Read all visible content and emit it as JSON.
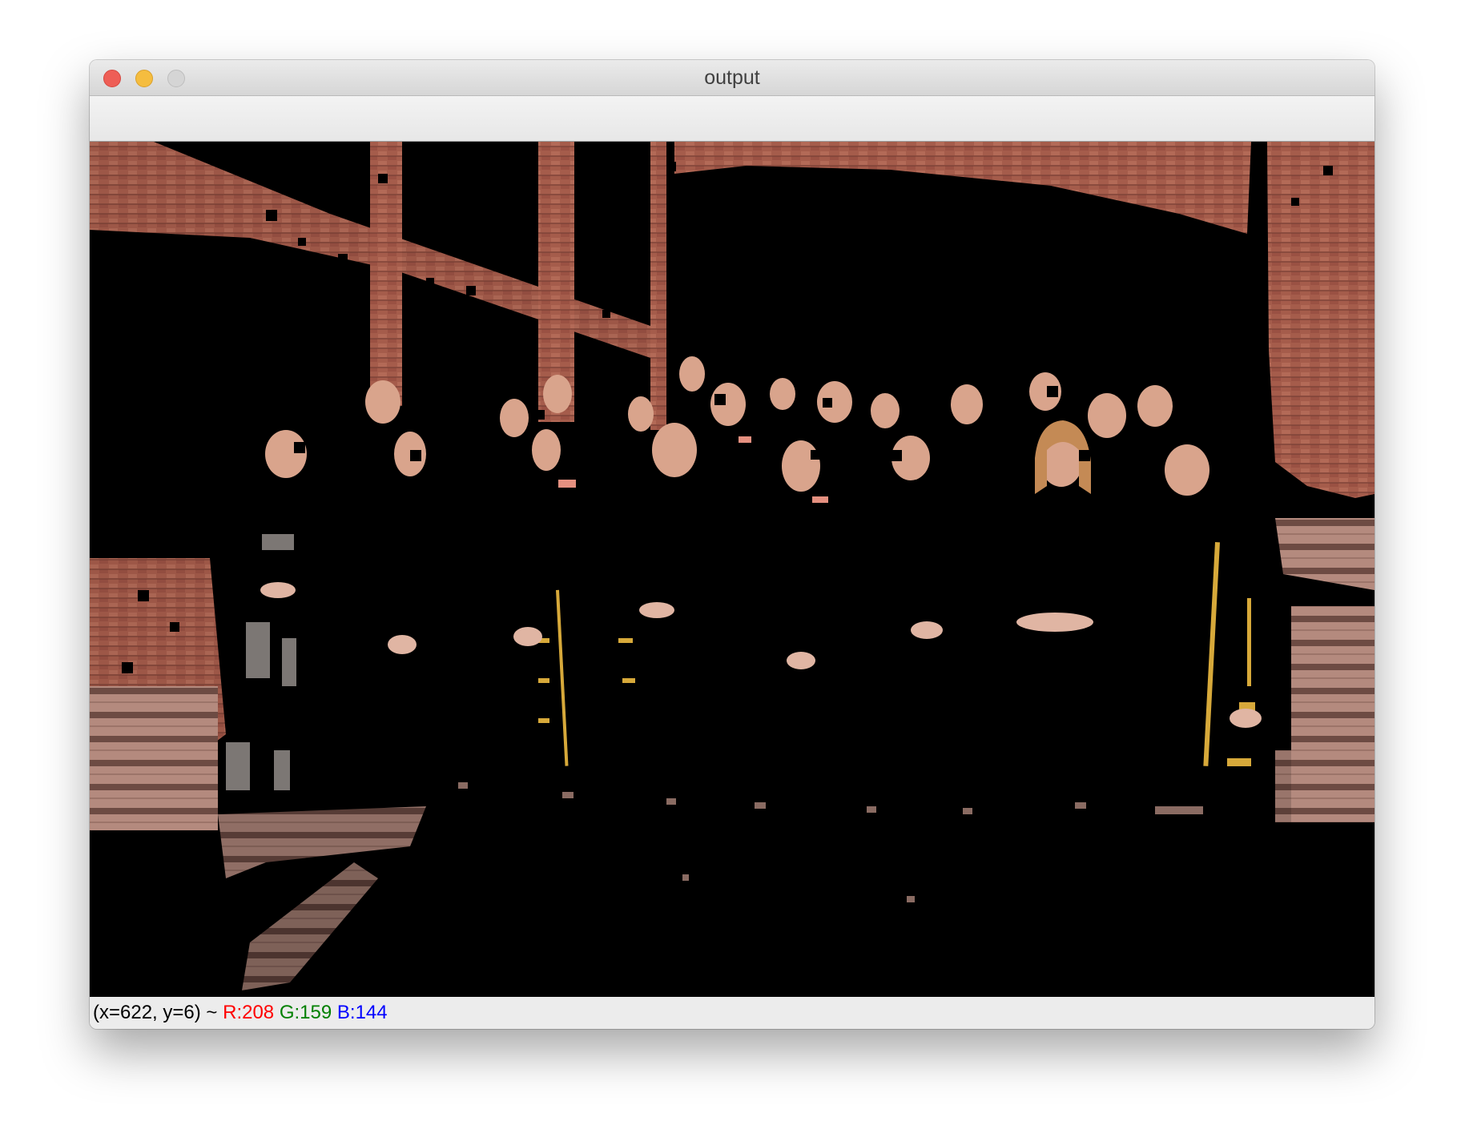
{
  "window": {
    "title": "output"
  },
  "status": {
    "coords": "(x=622, y=6) ~",
    "r": "R:208",
    "g": "G:159",
    "b": "B:144",
    "colors": {
      "r": "#ff0000",
      "g": "#008000",
      "b": "#0000ff"
    }
  },
  "image": {
    "description_icon": "segmented-photo",
    "colors": {
      "background": "#000000",
      "brick": "#a8604f",
      "brick_dark": "#7a3e33",
      "stone": "#b98f83",
      "skin": "#d9a48c",
      "gold": "#d7a93a"
    }
  }
}
